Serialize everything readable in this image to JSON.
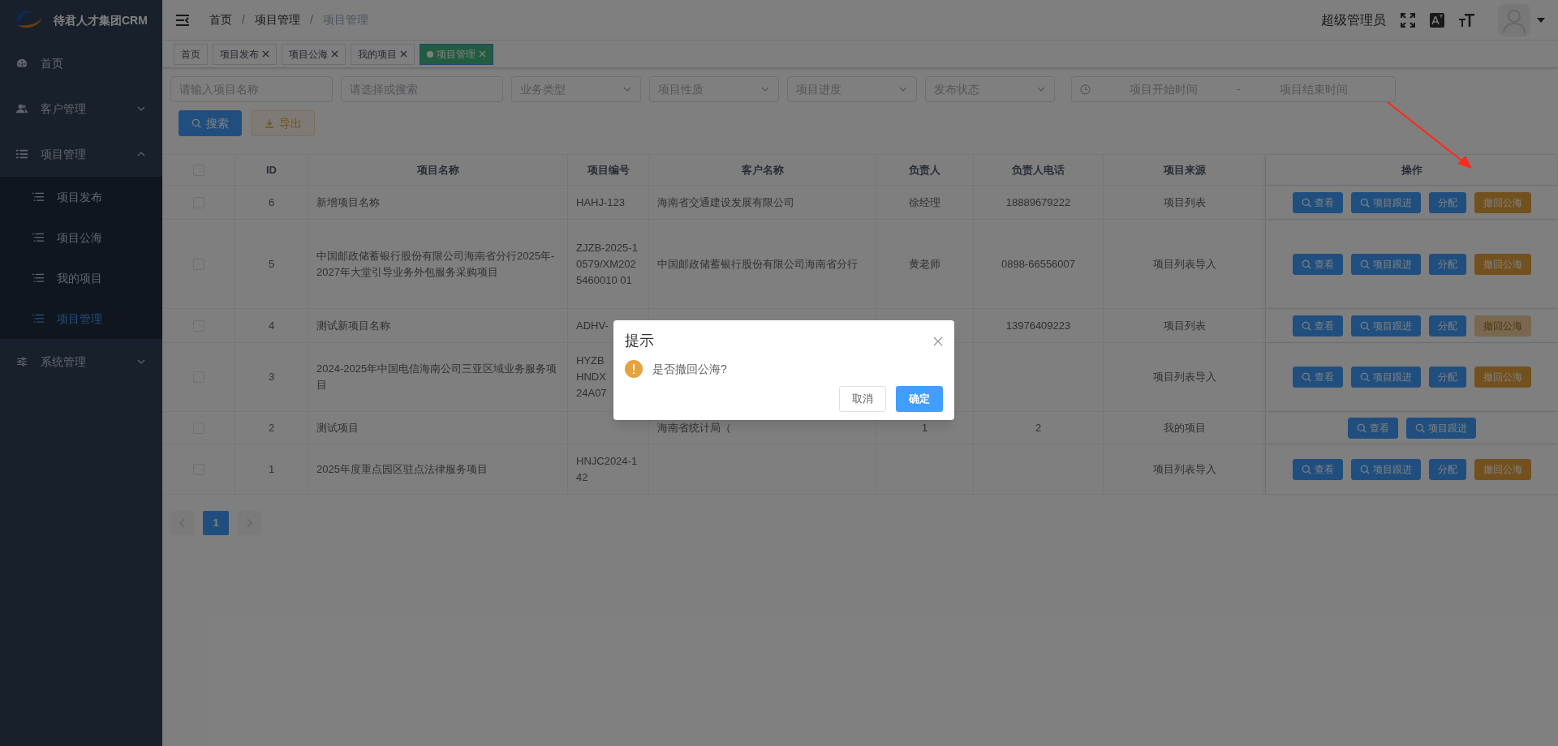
{
  "logo": {
    "title": "待君人才集团CRM"
  },
  "sidebar": {
    "items": [
      {
        "label": "首页"
      },
      {
        "label": "客户管理",
        "expanded": false
      },
      {
        "label": "项目管理",
        "expanded": true,
        "children": [
          {
            "label": "项目发布",
            "selected": false
          },
          {
            "label": "项目公海",
            "selected": false
          },
          {
            "label": "我的项目",
            "selected": false
          },
          {
            "label": "项目管理",
            "selected": true
          }
        ]
      },
      {
        "label": "系统管理",
        "expanded": false
      }
    ]
  },
  "breadcrumb": {
    "items": [
      "首页",
      "项目管理",
      "项目管理"
    ],
    "separator": "/"
  },
  "user": {
    "name": "超级管理员"
  },
  "tabs": [
    {
      "label": "首页",
      "selected": false,
      "closable": false
    },
    {
      "label": "项目发布",
      "selected": false,
      "closable": true
    },
    {
      "label": "项目公海",
      "selected": false,
      "closable": true
    },
    {
      "label": "我的项目",
      "selected": false,
      "closable": true
    },
    {
      "label": "项目管理",
      "selected": true,
      "closable": true
    }
  ],
  "filters": [
    {
      "kind": "input",
      "placeholder": "请输入项目名称"
    },
    {
      "kind": "input",
      "placeholder": "请选择或搜索"
    },
    {
      "kind": "select",
      "placeholder": "业务类型"
    },
    {
      "kind": "select",
      "placeholder": "项目性质"
    },
    {
      "kind": "select",
      "placeholder": "项目进度"
    },
    {
      "kind": "select",
      "placeholder": "发布状态"
    }
  ],
  "date_range": {
    "start_placeholder": "项目开始时间",
    "separator": "-",
    "end_placeholder": "项目结束时间"
  },
  "buttons": [
    {
      "label": "搜索",
      "kind": "primary"
    },
    {
      "label": "导出",
      "kind": "export"
    }
  ],
  "table": {
    "all_checked": false,
    "columns": [
      "ID",
      "项目名称",
      "项目编号",
      "客户名称",
      "负责人",
      "负责人电话",
      "项目来源",
      "操作"
    ],
    "rows": [
      {
        "checked": false,
        "cells": [
          "6",
          "新增项目名称",
          "HAHJ-123",
          "海南省交通建设发展有限公司",
          "徐经理",
          "18889679222",
          "项目列表"
        ],
        "actions": [
          {
            "label": "查看",
            "kind": "search",
            "disabled": false
          },
          {
            "label": "项目跟进",
            "kind": "search",
            "disabled": false
          },
          {
            "label": "分配",
            "kind": "primary",
            "disabled": false
          },
          {
            "label": "撤回公海",
            "kind": "warning",
            "disabled": false
          }
        ]
      },
      {
        "checked": false,
        "cells": [
          "5",
          "中国邮政储蓄银行股份有限公司海南省分行2025年-2027年大堂引导业务外包服务采购项目",
          "ZJZB-2025-10579/XM2025460010 01",
          "中国邮政储蓄银行股份有限公司海南省分行",
          "黄老师",
          "0898-66556007",
          "项目列表导入"
        ],
        "actions": [
          {
            "label": "查看",
            "kind": "search",
            "disabled": false
          },
          {
            "label": "项目跟进",
            "kind": "search",
            "disabled": false
          },
          {
            "label": "分配",
            "kind": "primary",
            "disabled": false
          },
          {
            "label": "撤回公海",
            "kind": "warning",
            "disabled": false
          }
        ]
      },
      {
        "checked": false,
        "cells": [
          "4",
          "测试新项目名称",
          "ADHV-",
          "",
          "",
          "13976409223",
          "项目列表"
        ],
        "actions": [
          {
            "label": "查看",
            "kind": "search",
            "disabled": false
          },
          {
            "label": "项目跟进",
            "kind": "search",
            "disabled": false
          },
          {
            "label": "分配",
            "kind": "primary",
            "disabled": false
          },
          {
            "label": "撤回公海",
            "kind": "warning",
            "disabled": true
          }
        ]
      },
      {
        "checked": false,
        "cells": [
          "3",
          "2024-2025年中国电信海南公司三亚区域业务服务项目",
          "HYZB\nHNDX\n24A07",
          "",
          "",
          "",
          "项目列表导入"
        ],
        "actions": [
          {
            "label": "查看",
            "kind": "search",
            "disabled": false
          },
          {
            "label": "项目跟进",
            "kind": "search",
            "disabled": false
          },
          {
            "label": "分配",
            "kind": "primary",
            "disabled": false
          },
          {
            "label": "撤回公海",
            "kind": "warning",
            "disabled": false
          }
        ]
      },
      {
        "checked": false,
        "cells": [
          "2",
          "测试项目",
          "",
          "海南省统计局（",
          "1",
          "2",
          "我的项目"
        ],
        "actions": [
          {
            "label": "查看",
            "kind": "search",
            "disabled": false
          },
          {
            "label": "项目跟进",
            "kind": "search",
            "disabled": false
          }
        ]
      },
      {
        "checked": false,
        "cells": [
          "1",
          "2025年度重点园区驻点法律服务项目",
          "HNJC2024-142",
          "",
          "",
          "",
          "项目列表导入"
        ],
        "actions": [
          {
            "label": "查看",
            "kind": "search",
            "disabled": false
          },
          {
            "label": "项目跟进",
            "kind": "search",
            "disabled": false
          },
          {
            "label": "分配",
            "kind": "primary",
            "disabled": false
          },
          {
            "label": "撤回公海",
            "kind": "warning",
            "disabled": false
          }
        ]
      }
    ]
  },
  "pagination": {
    "pages": [
      {
        "label": "1",
        "selected": true
      }
    ]
  },
  "dialog": {
    "title": "提示",
    "message": "是否撤回公海?",
    "buttons": [
      {
        "label": "取消",
        "kind": "default"
      },
      {
        "label": "确定",
        "kind": "primary"
      }
    ]
  }
}
